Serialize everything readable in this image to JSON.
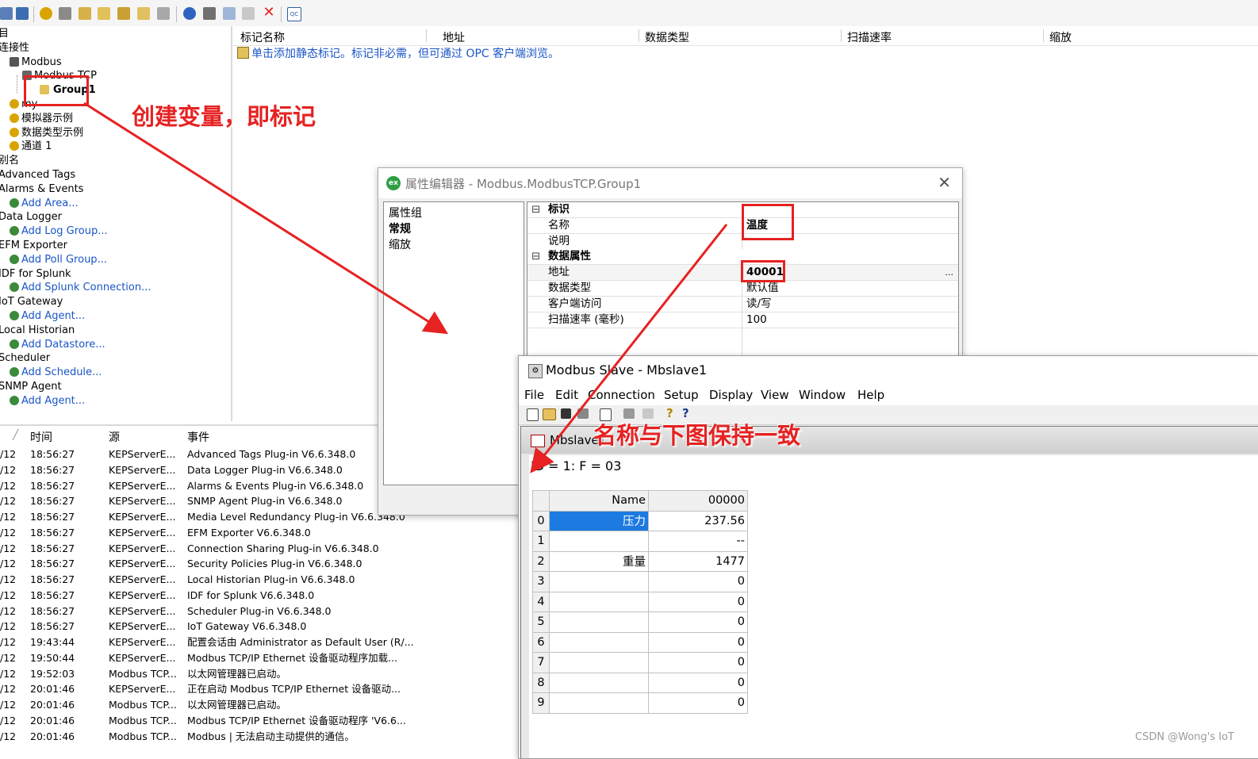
{
  "colors": {
    "accent_red": "#e62222",
    "link_blue": "#1a55c7",
    "selection_blue": "#1d7ae0"
  },
  "tree": {
    "items": [
      {
        "label": "目",
        "kind": "text",
        "indent": 0,
        "icon": "none"
      },
      {
        "label": "连接性",
        "kind": "text",
        "indent": 0,
        "icon": "none"
      },
      {
        "label": "Modbus",
        "kind": "text",
        "indent": 14,
        "icon": "device-icon"
      },
      {
        "label": "Modbus TCP",
        "kind": "text",
        "indent": 30,
        "icon": "grid-device-icon"
      },
      {
        "label": "Group1",
        "kind": "selected",
        "indent": 52,
        "icon": "folder-tag-icon"
      },
      {
        "label": "my",
        "kind": "text",
        "indent": 14,
        "icon": "gear-icon"
      },
      {
        "label": "模拟器示例",
        "kind": "text",
        "indent": 14,
        "icon": "gear-icon"
      },
      {
        "label": "数据类型示例",
        "kind": "text",
        "indent": 14,
        "icon": "gear-icon"
      },
      {
        "label": "通道 1",
        "kind": "text",
        "indent": 14,
        "icon": "gear-icon"
      },
      {
        "label": "别名",
        "kind": "text",
        "indent": 0,
        "icon": "none"
      },
      {
        "label": "Advanced Tags",
        "kind": "text",
        "indent": 0,
        "icon": "none"
      },
      {
        "label": "Alarms & Events",
        "kind": "text",
        "indent": 0,
        "icon": "none"
      },
      {
        "label": "Add Area...",
        "kind": "link",
        "indent": 14,
        "icon": "add-icon"
      },
      {
        "label": "Data Logger",
        "kind": "text",
        "indent": 0,
        "icon": "none"
      },
      {
        "label": "Add Log Group...",
        "kind": "link",
        "indent": 14,
        "icon": "add-icon"
      },
      {
        "label": "EFM Exporter",
        "kind": "text",
        "indent": 0,
        "icon": "none"
      },
      {
        "label": "Add Poll Group...",
        "kind": "link",
        "indent": 14,
        "icon": "add-icon"
      },
      {
        "label": "IDF for Splunk",
        "kind": "text",
        "indent": 0,
        "icon": "none"
      },
      {
        "label": "Add Splunk Connection...",
        "kind": "link",
        "indent": 14,
        "icon": "add-icon"
      },
      {
        "label": "IoT Gateway",
        "kind": "text",
        "indent": 0,
        "icon": "none"
      },
      {
        "label": "Add Agent...",
        "kind": "link",
        "indent": 14,
        "icon": "add-icon"
      },
      {
        "label": "Local Historian",
        "kind": "text",
        "indent": 0,
        "icon": "none"
      },
      {
        "label": "Add Datastore...",
        "kind": "link",
        "indent": 14,
        "icon": "add-icon"
      },
      {
        "label": "Scheduler",
        "kind": "text",
        "indent": 0,
        "icon": "none"
      },
      {
        "label": "Add Schedule...",
        "kind": "link",
        "indent": 14,
        "icon": "add-icon"
      },
      {
        "label": "SNMP Agent",
        "kind": "text",
        "indent": 0,
        "icon": "none"
      },
      {
        "label": "Add Agent...",
        "kind": "link",
        "indent": 14,
        "icon": "add-icon"
      }
    ]
  },
  "taglist": {
    "columns": [
      "标记名称",
      "地址",
      "数据类型",
      "扫描速率",
      "缩放"
    ],
    "hint": "单击添加静态标记。标记非必需，但可通过 OPC 客户端浏览。"
  },
  "annotations": {
    "create_tag": "创建变量，即标记",
    "name_match": "名称与下图保持一致"
  },
  "events": {
    "columns": [
      "时间",
      "源",
      "事件"
    ],
    "rows": [
      [
        "/12",
        "18:56:27",
        "KEPServerE...",
        "Advanced Tags Plug-in V6.6.348.0"
      ],
      [
        "/12",
        "18:56:27",
        "KEPServerE...",
        "Data Logger Plug-in V6.6.348.0"
      ],
      [
        "/12",
        "18:56:27",
        "KEPServerE...",
        "Alarms & Events Plug-in V6.6.348.0"
      ],
      [
        "/12",
        "18:56:27",
        "KEPServerE...",
        "SNMP Agent Plug-in V6.6.348.0"
      ],
      [
        "/12",
        "18:56:27",
        "KEPServerE...",
        "Media Level Redundancy Plug-in V6.6.348.0"
      ],
      [
        "/12",
        "18:56:27",
        "KEPServerE...",
        "EFM Exporter V6.6.348.0"
      ],
      [
        "/12",
        "18:56:27",
        "KEPServerE...",
        "Connection Sharing Plug-in V6.6.348.0"
      ],
      [
        "/12",
        "18:56:27",
        "KEPServerE...",
        "Security Policies Plug-in V6.6.348.0"
      ],
      [
        "/12",
        "18:56:27",
        "KEPServerE...",
        "Local Historian Plug-in V6.6.348.0"
      ],
      [
        "/12",
        "18:56:27",
        "KEPServerE...",
        "IDF for Splunk V6.6.348.0"
      ],
      [
        "/12",
        "18:56:27",
        "KEPServerE...",
        "Scheduler Plug-in V6.6.348.0"
      ],
      [
        "/12",
        "18:56:27",
        "KEPServerE...",
        "IoT Gateway V6.6.348.0"
      ],
      [
        "/12",
        "19:43:44",
        "KEPServerE...",
        "配置会话由 Administrator as Default User (R/..."
      ],
      [
        "/12",
        "19:50:44",
        "KEPServerE...",
        "Modbus TCP/IP Ethernet 设备驱动程序加载..."
      ],
      [
        "/12",
        "19:52:03",
        "Modbus TCP...",
        "以太网管理器已启动。"
      ],
      [
        "/12",
        "20:01:46",
        "KEPServerE...",
        "正在启动 Modbus TCP/IP Ethernet 设备驱动..."
      ],
      [
        "/12",
        "20:01:46",
        "Modbus TCP...",
        "以太网管理器已启动。"
      ],
      [
        "/12",
        "20:01:46",
        "Modbus TCP...",
        "Modbus TCP/IP Ethernet 设备驱动程序 'V6.6..."
      ],
      [
        "/12",
        "20:01:46",
        "Modbus TCP...",
        "Modbus | 无法启动主动提供的通信。"
      ]
    ]
  },
  "property_editor": {
    "title": "属性编辑器 - Modbus.ModbusTCP.Group1",
    "logo": "ex",
    "groups_header": "属性组",
    "groups": [
      "常规",
      "缩放"
    ],
    "rows": [
      {
        "kind": "cat",
        "name": "标识",
        "value": ""
      },
      {
        "kind": "prop",
        "name": "名称",
        "value": "温度",
        "bold": true
      },
      {
        "kind": "prop",
        "name": "说明",
        "value": ""
      },
      {
        "kind": "cat",
        "name": "数据属性",
        "value": ""
      },
      {
        "kind": "prop",
        "name": "地址",
        "value": "40001",
        "bold": true,
        "ellipsis": "..."
      },
      {
        "kind": "prop",
        "name": "数据类型",
        "value": "默认值"
      },
      {
        "kind": "prop",
        "name": "客户端访问",
        "value": "读/写"
      },
      {
        "kind": "prop",
        "name": "扫描速率 (毫秒)",
        "value": "100"
      }
    ]
  },
  "modbus_slave": {
    "title": "Modbus Slave - Mbslave1",
    "menu": [
      "File",
      "Edit",
      "Connection",
      "Setup",
      "Display",
      "View",
      "Window",
      "Help"
    ],
    "child_title": "Mbslave1",
    "status": "ID = 1: F = 03",
    "table": {
      "header": [
        "Name",
        "00000"
      ],
      "rows": [
        {
          "idx": "0",
          "name": "压力",
          "value": "237.56",
          "selected": true
        },
        {
          "idx": "1",
          "name": "",
          "value": "--"
        },
        {
          "idx": "2",
          "name": "重量",
          "value": "1477"
        },
        {
          "idx": "3",
          "name": "",
          "value": "0"
        },
        {
          "idx": "4",
          "name": "",
          "value": "0"
        },
        {
          "idx": "5",
          "name": "",
          "value": "0"
        },
        {
          "idx": "6",
          "name": "",
          "value": "0"
        },
        {
          "idx": "7",
          "name": "",
          "value": "0"
        },
        {
          "idx": "8",
          "name": "",
          "value": "0"
        },
        {
          "idx": "9",
          "name": "",
          "value": "0"
        }
      ]
    }
  },
  "watermark": "CSDN @Wong's IoT"
}
